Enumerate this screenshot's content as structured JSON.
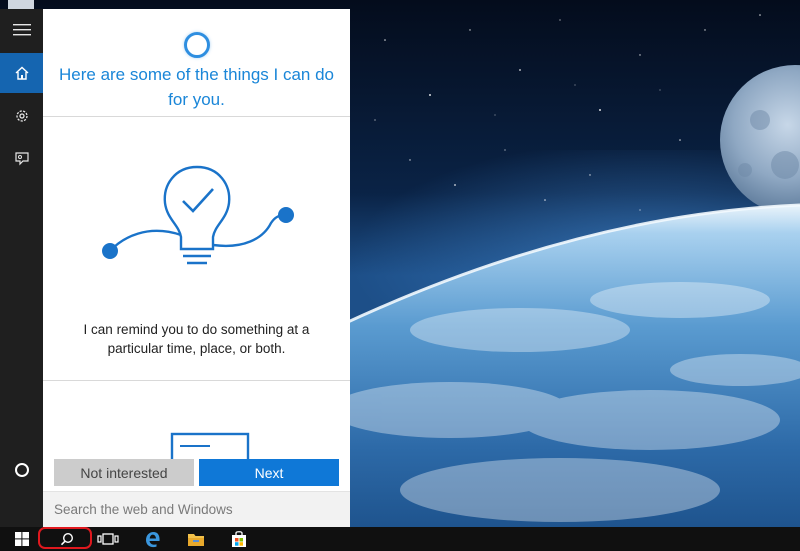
{
  "cortana": {
    "title": "Here are some of the things I can do for you.",
    "reminder_text": "I can remind you to do something at a particular time, place, or both.",
    "not_interested_label": "Not interested",
    "next_label": "Next"
  },
  "search": {
    "placeholder": "Search the web and Windows"
  },
  "rail": {
    "items": [
      {
        "icon": "hamburger-menu-icon"
      },
      {
        "icon": "home-icon",
        "active": true
      },
      {
        "icon": "gear-icon"
      },
      {
        "icon": "feedback-icon"
      },
      {
        "icon": "cortana-ring-icon"
      }
    ]
  },
  "taskbar": {
    "items": [
      {
        "icon": "windows-start-icon"
      },
      {
        "icon": "search-icon",
        "highlighted": true
      },
      {
        "icon": "task-view-icon"
      },
      {
        "icon": "edge-browser-icon"
      },
      {
        "icon": "file-explorer-icon"
      },
      {
        "icon": "store-icon"
      }
    ]
  },
  "colors": {
    "accent": "#0f78d7",
    "title_blue": "#1a86d8",
    "highlight_red": "#e0181e"
  }
}
